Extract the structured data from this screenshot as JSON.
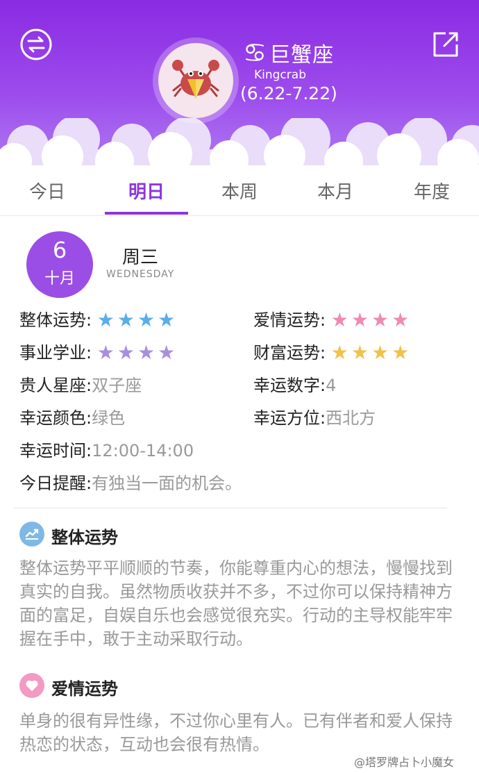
{
  "header": {
    "zodiac_symbol": "♋",
    "zodiac_name": "巨蟹座",
    "zodiac_en": "Kingcrab",
    "date_range": "(6.22-7.22)",
    "swap_icon": "swap-icon",
    "share_icon": "share-icon",
    "bg_color": "#8A2BE2"
  },
  "tabs": [
    {
      "label": "今日"
    },
    {
      "label": "明日"
    },
    {
      "label": "本周"
    },
    {
      "label": "本月"
    },
    {
      "label": "年度"
    }
  ],
  "active_tab": "明日",
  "date": {
    "day": "6",
    "month": "十月",
    "weekday_cn": "周三",
    "weekday_en": "WEDNESDAY"
  },
  "fortune": {
    "overall": {
      "label": "整体运势:",
      "stars": 4,
      "color": "#5aaee8"
    },
    "love": {
      "label": "爱情运势:",
      "stars": 4,
      "color": "#f08ab2"
    },
    "career": {
      "label": "事业学业:",
      "stars": 4,
      "color": "#a98ee0"
    },
    "wealth": {
      "label": "财富运势:",
      "stars": 4,
      "color": "#f0c24a"
    },
    "noble": {
      "label": "贵人星座:",
      "value": "双子座"
    },
    "lucky_number": {
      "label": "幸运数字:",
      "value": "4"
    },
    "lucky_color": {
      "label": "幸运颜色:",
      "value": "绿色"
    },
    "lucky_direction": {
      "label": "幸运方位:",
      "value": "西北方"
    },
    "lucky_time": {
      "label": "幸运时间:",
      "value": "12:00-14:00"
    },
    "reminder": {
      "label": "今日提醒:",
      "value": "有独当一面的机会。"
    }
  },
  "sections": [
    {
      "title": "整体运势",
      "icon": "chart-icon",
      "text": "整体运势平平顺顺的节奏，你能尊重内心的想法，慢慢找到真实的自我。虽然物质收获并不多，不过你可以保持精神方面的富足，自娱自乐也会感觉很充实。行动的主导权能牢牢握在手中，敢于主动采取行动。"
    },
    {
      "title": "爱情运势",
      "icon": "heart-icon",
      "text": "单身的很有异性缘，不过你心里有人。已有伴者和爱人保持热恋的状态，互动也会很有热情。"
    }
  ],
  "watermark": "@塔罗牌占卜小魔女"
}
